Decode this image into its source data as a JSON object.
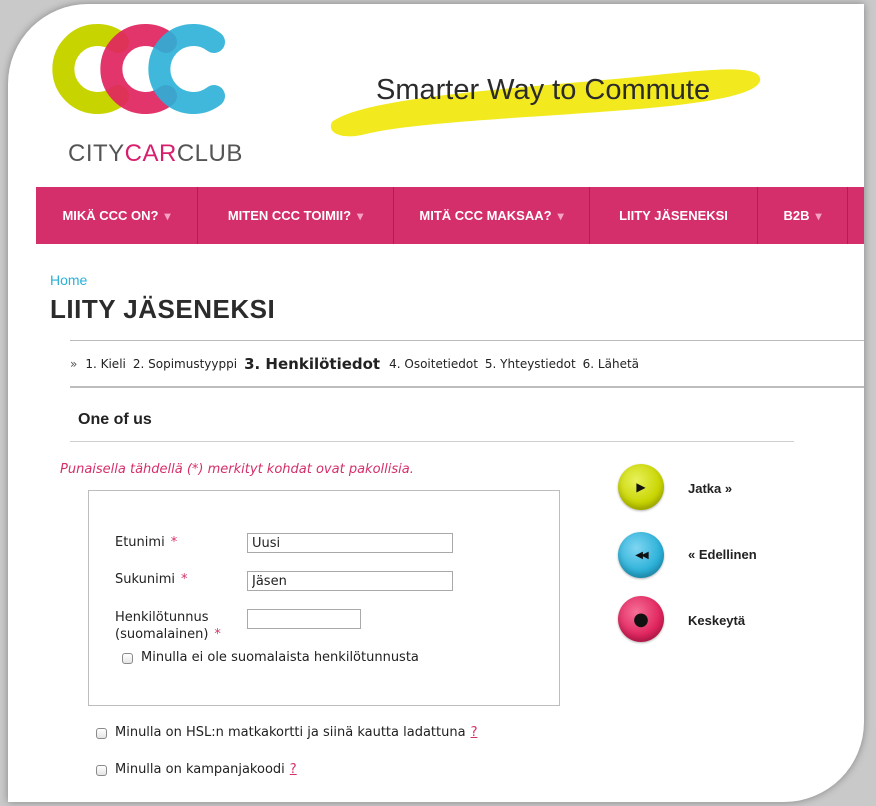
{
  "brand": {
    "part1": "CITY",
    "part2": "CAR",
    "part3": "CLUB",
    "tagline": "Smarter Way to Commute"
  },
  "colors": {
    "nav": "#d52f6b",
    "accent_pink": "#d81f6d",
    "lime": "#c8d400",
    "cyan": "#2bb0d8",
    "tagline_bg": "#f2ea1e"
  },
  "nav": [
    {
      "label": "MIKÄ CCC ON?",
      "caret": "▾"
    },
    {
      "label": "MITEN CCC TOIMII?",
      "caret": "▾"
    },
    {
      "label": "MITÄ CCC MAKSAA?",
      "caret": "▾"
    },
    {
      "label": "LIITY JÄSENEKSI",
      "caret": ""
    },
    {
      "label": "B2B",
      "caret": "▾"
    }
  ],
  "breadcrumb": {
    "home": "Home"
  },
  "page_title": "LIITY JÄSENEKSI",
  "steps": {
    "arrow": "»",
    "items": [
      "1. Kieli",
      "2. Sopimustyyppi",
      "3. Henkilötiedot",
      "4. Osoitetiedot",
      "5. Yhteystiedot",
      "6. Lähetä"
    ],
    "current_index": 2
  },
  "section_heading": "One of us",
  "required_note": "Punaisella tähdellä (*) merkityt kohdat ovat pakollisia.",
  "form": {
    "first_name": {
      "label": "Etunimi",
      "value": "Uusi"
    },
    "last_name": {
      "label": "Sukunimi",
      "value": "Jäsen"
    },
    "ssn": {
      "label_line1": "Henkilötunnus",
      "label_line2": "(suomalainen)",
      "value": ""
    },
    "no_ssn_checkbox": "Minulla ei ole suomalaista henkilötunnusta",
    "required_mark": "*"
  },
  "extra_checkboxes": [
    {
      "label": "Minulla on HSL:n matkakortti ja siinä kautta ladattuna",
      "help": "?"
    },
    {
      "label": "Minulla on kampanjakoodi",
      "help": "?"
    }
  ],
  "actions": [
    {
      "label": "Jatka  »",
      "icon": "play-icon",
      "glyph": "▶",
      "color": "#c8d400"
    },
    {
      "label": "« Edellinen",
      "icon": "rewind-icon",
      "glyph": "◀◀",
      "color": "#2bb0d8"
    },
    {
      "label": "Keskeytä",
      "icon": "stop-icon",
      "glyph": "●",
      "color": "#e0245e"
    }
  ]
}
